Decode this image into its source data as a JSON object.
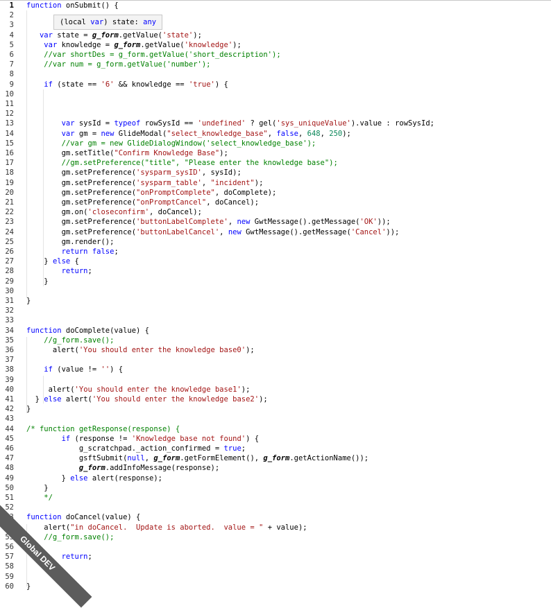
{
  "tooltip": {
    "prefix": "(local ",
    "kind": "var",
    "suffix": ") state: ",
    "type": "any"
  },
  "watermark": "Global DEV",
  "lines": [
    {
      "n": "1",
      "t": "function onSubmit() {"
    },
    {
      "n": "2",
      "t": ""
    },
    {
      "n": "3",
      "t": ""
    },
    {
      "n": "4",
      "t": "   var state = g_form.getValue('state');"
    },
    {
      "n": "5",
      "t": "    var knowledge = g_form.getValue('knowledge');"
    },
    {
      "n": "6",
      "t": "    //var shortDes = g_form.getValue('short_description');"
    },
    {
      "n": "7",
      "t": "    //var num = g_form.getValue('number');"
    },
    {
      "n": "8",
      "t": ""
    },
    {
      "n": "9",
      "t": "    if (state == '6' && knowledge == 'true') {"
    },
    {
      "n": "10",
      "t": ""
    },
    {
      "n": "11",
      "t": ""
    },
    {
      "n": "12",
      "t": ""
    },
    {
      "n": "13",
      "t": "        var sysId = typeof rowSysId == 'undefined' ? gel('sys_uniqueValue').value : rowSysId;"
    },
    {
      "n": "14",
      "t": "        var gm = new GlideModal(\"select_knowledge_base\", false, 648, 250);"
    },
    {
      "n": "15",
      "t": "        //var gm = new GlideDialogWindow('select_knowledge_base');"
    },
    {
      "n": "16",
      "t": "        gm.setTitle(\"Confirm Knowledge Base\");"
    },
    {
      "n": "17",
      "t": "        //gm.setPreference(\"title\", \"Please enter the knowledge base\");"
    },
    {
      "n": "18",
      "t": "        gm.setPreference('sysparm_sysID', sysId);"
    },
    {
      "n": "19",
      "t": "        gm.setPreference('sysparm_table', \"incident\");"
    },
    {
      "n": "20",
      "t": "        gm.setPreference(\"onPromptComplete\", doComplete);"
    },
    {
      "n": "21",
      "t": "        gm.setPreference(\"onPromptCancel\", doCancel);"
    },
    {
      "n": "22",
      "t": "        gm.on('closeconfirm', doCancel);"
    },
    {
      "n": "23",
      "t": "        gm.setPreference('buttonLabelComplete', new GwtMessage().getMessage('OK'));"
    },
    {
      "n": "24",
      "t": "        gm.setPreference('buttonLabelCancel', new GwtMessage().getMessage('Cancel'));"
    },
    {
      "n": "25",
      "t": "        gm.render();"
    },
    {
      "n": "26",
      "t": "        return false;"
    },
    {
      "n": "27",
      "t": "    } else {"
    },
    {
      "n": "28",
      "t": "        return;"
    },
    {
      "n": "29",
      "t": "    }"
    },
    {
      "n": "30",
      "t": ""
    },
    {
      "n": "31",
      "t": "}"
    },
    {
      "n": "32",
      "t": ""
    },
    {
      "n": "33",
      "t": ""
    },
    {
      "n": "34",
      "t": "function doComplete(value) {"
    },
    {
      "n": "35",
      "t": "    //g_form.save();"
    },
    {
      "n": "36",
      "t": "      alert('You should enter the knowledge base0');"
    },
    {
      "n": "37",
      "t": ""
    },
    {
      "n": "38",
      "t": "    if (value != '') {"
    },
    {
      "n": "39",
      "t": ""
    },
    {
      "n": "40",
      "t": "     alert('You should enter the knowledge base1');"
    },
    {
      "n": "41",
      "t": "  } else alert('You should enter the knowledge base2');"
    },
    {
      "n": "42",
      "t": "}"
    },
    {
      "n": "43",
      "t": ""
    },
    {
      "n": "44",
      "t": "/* function getResponse(response) {"
    },
    {
      "n": "45",
      "t": "        if (response != 'Knowledge base not found') {"
    },
    {
      "n": "46",
      "t": "            g_scratchpad._action_confirmed = true;"
    },
    {
      "n": "47",
      "t": "            gsftSubmit(null, g_form.getFormElement(), g_form.getActionName());"
    },
    {
      "n": "48",
      "t": "            g_form.addInfoMessage(response);"
    },
    {
      "n": "49",
      "t": "        } else alert(response);"
    },
    {
      "n": "50",
      "t": "    }"
    },
    {
      "n": "51",
      "t": "    */"
    },
    {
      "n": "52",
      "t": ""
    },
    {
      "n": "53",
      "t": "function doCancel(value) {"
    },
    {
      "n": "54",
      "t": "    alert(\"in doCancel.  Update is aborted.  value = \" + value);"
    },
    {
      "n": "55",
      "t": "    //g_form.save();"
    },
    {
      "n": "56",
      "t": ""
    },
    {
      "n": "57",
      "t": "        return;"
    },
    {
      "n": "58",
      "t": ""
    },
    {
      "n": "59",
      "t": ""
    },
    {
      "n": "60",
      "t": "}"
    }
  ]
}
